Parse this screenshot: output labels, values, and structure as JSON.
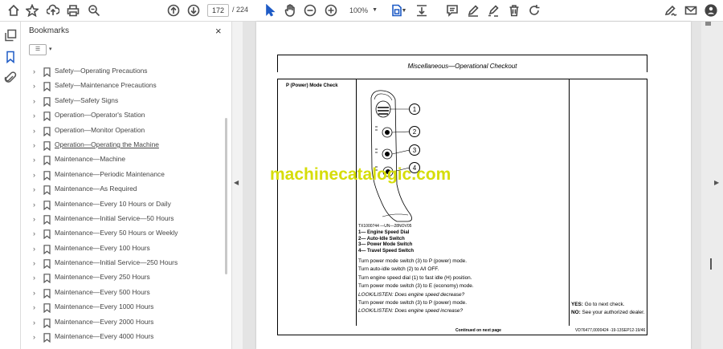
{
  "toolbar": {
    "page_current": "172",
    "page_total": "/ 224",
    "zoom": "100%",
    "icons": [
      "home-icon",
      "star-icon",
      "upload-icon",
      "print-icon",
      "zoom-search-icon",
      "page-up-icon",
      "page-down-icon",
      "select-cursor-icon",
      "hand-icon",
      "zoom-out-icon",
      "zoom-in-icon",
      "fit-page-icon",
      "scroll-mode-icon",
      "comment-icon",
      "pen-icon",
      "highlight-icon",
      "delete-icon",
      "rotate-icon",
      "sign-icon",
      "mail-icon",
      "account-icon"
    ]
  },
  "panel": {
    "title": "Bookmarks",
    "close": "×",
    "options": "☰"
  },
  "bookmarks": [
    {
      "label": "Safety—Operating Precautions"
    },
    {
      "label": "Safety—Maintenance Precautions"
    },
    {
      "label": "Safety—Safety Signs"
    },
    {
      "label": "Operation—Operator's Station"
    },
    {
      "label": "Operation—Monitor Operation"
    },
    {
      "label": "Operation—Operating the Machine"
    },
    {
      "label": "Maintenance—Machine"
    },
    {
      "label": "Maintenance—Periodic Maintenance"
    },
    {
      "label": "Maintenance—As Required"
    },
    {
      "label": "Maintenance—Every 10 Hours or Daily"
    },
    {
      "label": "Maintenance—Initial Service—50 Hours"
    },
    {
      "label": "Maintenance—Every 50 Hours or Weekly"
    },
    {
      "label": "Maintenance—Every 100 Hours"
    },
    {
      "label": "Maintenance—Initial Service—250 Hours"
    },
    {
      "label": "Maintenance—Every 250 Hours"
    },
    {
      "label": "Maintenance—Every 500 Hours"
    },
    {
      "label": "Maintenance—Every 1000 Hours"
    },
    {
      "label": "Maintenance—Every 2000 Hours"
    },
    {
      "label": "Maintenance—Every 4000 Hours"
    }
  ],
  "document": {
    "header": "Miscellaneous—Operational Checkout",
    "section_title": "P (Power) Mode Check",
    "figure_caption": "TX1000744 —UN—28NOV05",
    "callouts": [
      "1",
      "2",
      "3",
      "4"
    ],
    "legend": [
      "1— Engine Speed Dial",
      "2— Auto-Idle Switch",
      "3— Power Mode Switch",
      "4— Travel Speed Switch"
    ],
    "steps": [
      "Turn power mode switch (3) to P (power) mode.",
      "Turn auto-idle switch (2) to A/I OFF.",
      "Turn engine speed dial (1) to fast idle (H) position.",
      "Turn power mode switch (3) to E (economy) mode.",
      "LOOK/LISTEN:  Does engine speed decrease?",
      "Turn power mode switch (3) to P (power) mode.",
      "LOOK/LISTEN:  Does engine speed increase?"
    ],
    "yes_label": "YES:",
    "yes_text": "Go to next check.",
    "no_label": "NO:",
    "no_text": "See your authorized dealer.",
    "continued": "Continued on next page",
    "ref_code": "VD76477,0000424 -19-13SEP12-19/46",
    "watermark": "machinecatalogic.com"
  }
}
